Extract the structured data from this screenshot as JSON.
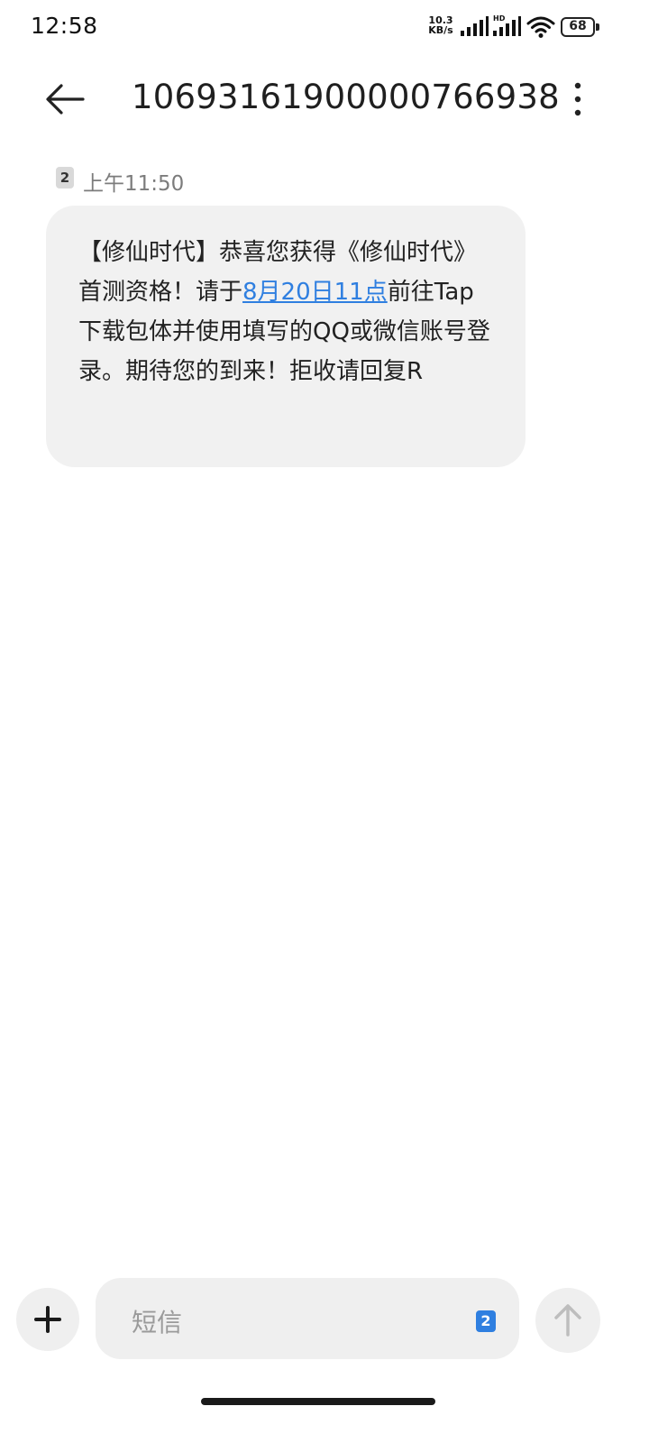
{
  "status_bar": {
    "time": "12:58",
    "net_speed_value": "10.3",
    "net_speed_unit": "KB/s",
    "hd_label": "HD",
    "battery_level": "68"
  },
  "header": {
    "title": "10693161900000766938"
  },
  "message": {
    "sim_slot": "2",
    "time": "上午11:50",
    "text_before_link": "【修仙时代】恭喜您获得《修仙时代》首测资格！请于",
    "link_text": "8月20日11点",
    "text_after_link": "前往Tap下载包体并使用填写的QQ或微信账号登录。期待您的到来！拒收请回复R"
  },
  "composer": {
    "placeholder": "短信",
    "sim_slot": "2"
  },
  "icons": {
    "back": "arrow-left-icon",
    "more": "more-vertical-icon",
    "add": "plus-icon",
    "send": "arrow-up-icon"
  },
  "colors": {
    "link": "#2f7fe0",
    "bubble_bg": "#f1f1f1",
    "sim_badge_bg": "#2f7fe0"
  }
}
